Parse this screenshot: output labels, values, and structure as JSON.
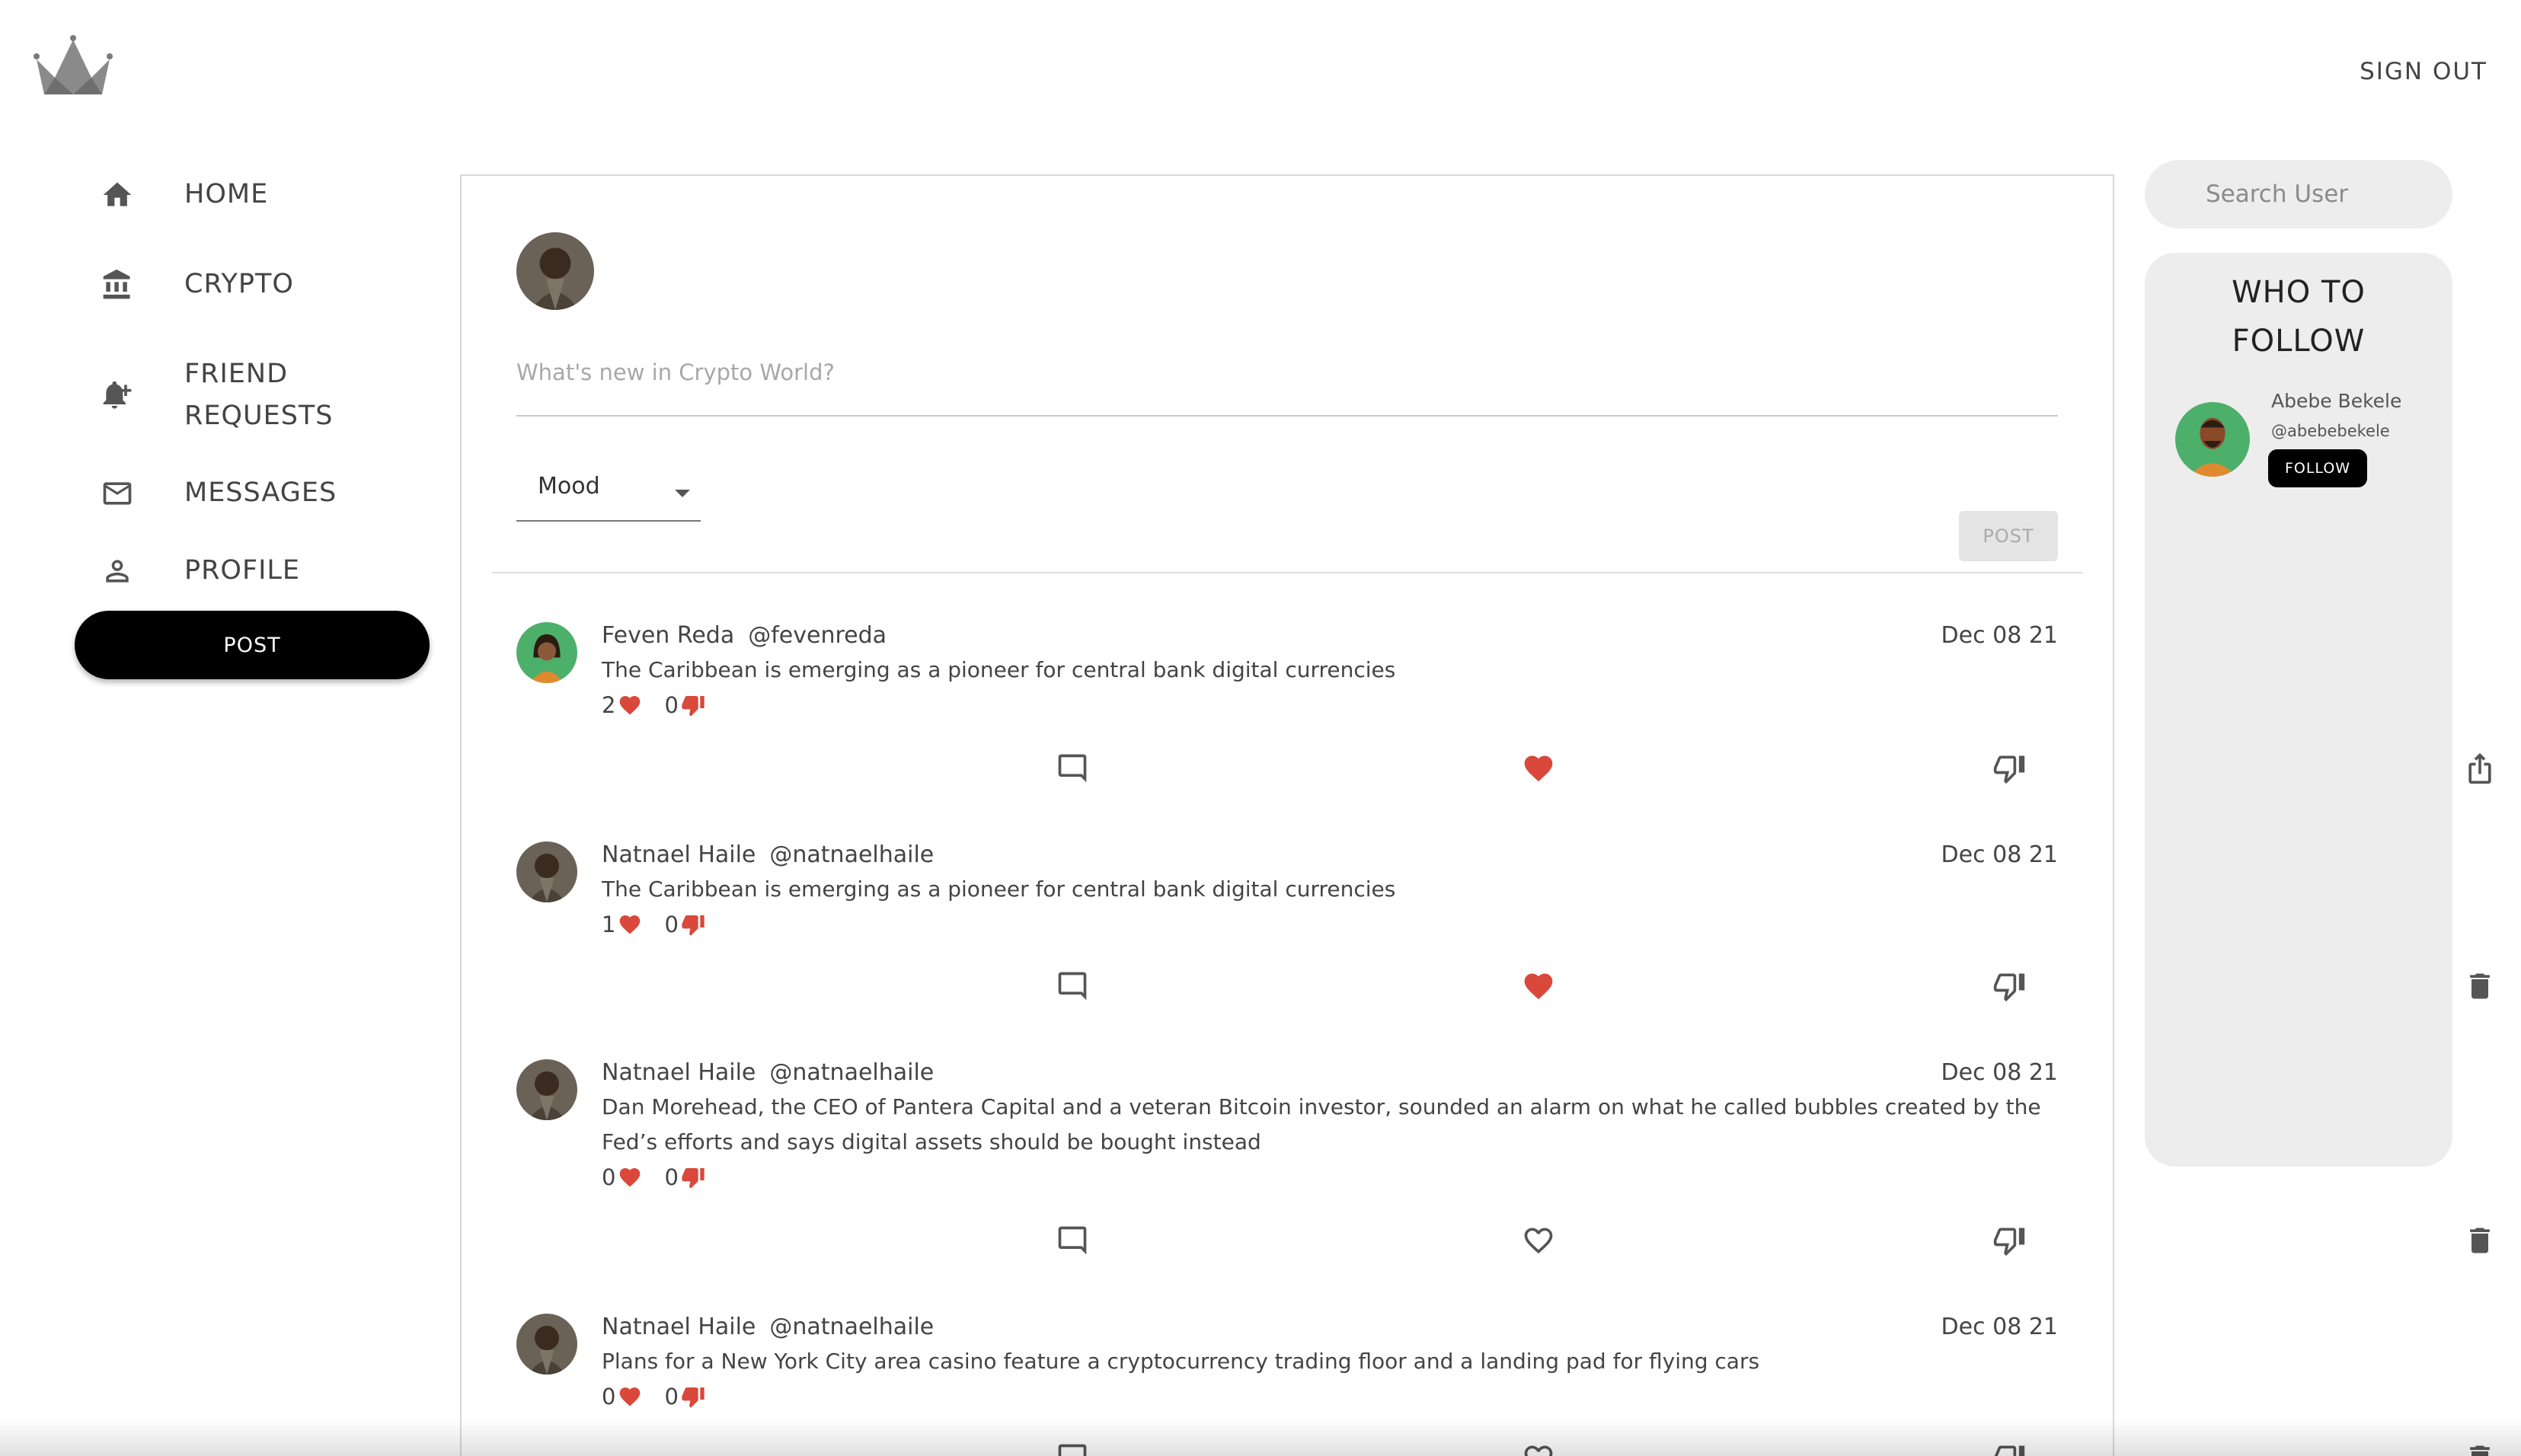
{
  "header": {
    "signout_label": "SIGN OUT",
    "logo_icon": "crown-icon"
  },
  "sidebar": {
    "items": [
      {
        "label": "HOME",
        "icon": "home-icon"
      },
      {
        "label": "CRYPTO",
        "icon": "bank-icon"
      },
      {
        "label_line1": "FRIEND",
        "label_line2": "REQUESTS",
        "icon": "bell-plus-icon"
      },
      {
        "label": "MESSAGES",
        "icon": "mail-icon"
      },
      {
        "label": "PROFILE",
        "icon": "person-icon"
      }
    ],
    "post_label": "POST"
  },
  "composer": {
    "placeholder": "What's new in Crypto World?",
    "mood_label": "Mood",
    "post_label": "POST"
  },
  "posts": [
    {
      "name": "Feven Reda",
      "handle": "@fevenreda",
      "date": "Dec 08 21",
      "text": "The Caribbean is emerging as a pioneer for central bank digital currencies",
      "likes": "2",
      "dislikes": "0",
      "liked": true,
      "owner_action": "share-icon"
    },
    {
      "name": "Natnael Haile",
      "handle": "@natnaelhaile",
      "date": "Dec 08 21",
      "text": "The Caribbean is emerging as a pioneer for central bank digital currencies",
      "likes": "1",
      "dislikes": "0",
      "liked": true,
      "owner_action": "trash-icon"
    },
    {
      "name": "Natnael Haile",
      "handle": "@natnaelhaile",
      "date": "Dec 08 21",
      "text": "Dan Morehead, the CEO of Pantera Capital and a veteran Bitcoin investor, sounded an alarm on what he called bubbles created by the Fed’s efforts and says digital assets should be bought instead",
      "likes": "0",
      "dislikes": "0",
      "liked": false,
      "owner_action": "trash-icon"
    },
    {
      "name": "Natnael Haile",
      "handle": "@natnaelhaile",
      "date": "Dec 08 21",
      "text": "Plans for a New York City area casino feature a cryptocurrency trading floor and a landing pad for flying cars",
      "likes": "0",
      "dislikes": "0",
      "liked": false,
      "owner_action": "trash-icon"
    }
  ],
  "right_panel": {
    "search_placeholder": "Search User",
    "who_to_follow_line1": "WHO TO",
    "who_to_follow_line2": "FOLLOW",
    "suggestion": {
      "name": "Abebe Bekele",
      "handle": "@abebebekele",
      "follow_label": "FOLLOW"
    }
  },
  "colors": {
    "accent_red": "#d9483b",
    "button_black": "#000000",
    "panel_gray": "#ededed"
  }
}
